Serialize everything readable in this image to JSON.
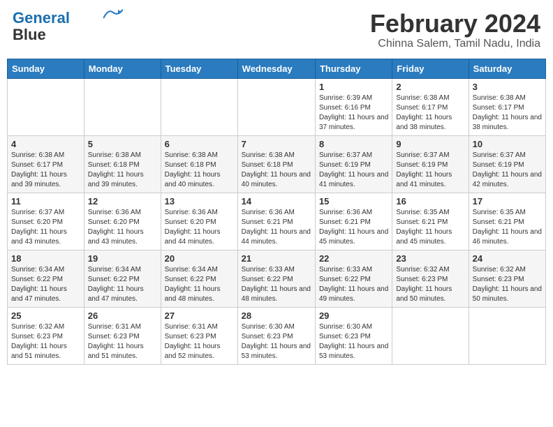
{
  "app": {
    "name": "GeneralBlue",
    "logo_line1": "General",
    "logo_line2": "Blue"
  },
  "header": {
    "month_year": "February 2024",
    "location": "Chinna Salem, Tamil Nadu, India"
  },
  "weekdays": [
    "Sunday",
    "Monday",
    "Tuesday",
    "Wednesday",
    "Thursday",
    "Friday",
    "Saturday"
  ],
  "weeks": [
    [
      {
        "day": "",
        "sunrise": "",
        "sunset": "",
        "daylight": ""
      },
      {
        "day": "",
        "sunrise": "",
        "sunset": "",
        "daylight": ""
      },
      {
        "day": "",
        "sunrise": "",
        "sunset": "",
        "daylight": ""
      },
      {
        "day": "",
        "sunrise": "",
        "sunset": "",
        "daylight": ""
      },
      {
        "day": "1",
        "sunrise": "Sunrise: 6:39 AM",
        "sunset": "Sunset: 6:16 PM",
        "daylight": "Daylight: 11 hours and 37 minutes."
      },
      {
        "day": "2",
        "sunrise": "Sunrise: 6:38 AM",
        "sunset": "Sunset: 6:17 PM",
        "daylight": "Daylight: 11 hours and 38 minutes."
      },
      {
        "day": "3",
        "sunrise": "Sunrise: 6:38 AM",
        "sunset": "Sunset: 6:17 PM",
        "daylight": "Daylight: 11 hours and 38 minutes."
      }
    ],
    [
      {
        "day": "4",
        "sunrise": "Sunrise: 6:38 AM",
        "sunset": "Sunset: 6:17 PM",
        "daylight": "Daylight: 11 hours and 39 minutes."
      },
      {
        "day": "5",
        "sunrise": "Sunrise: 6:38 AM",
        "sunset": "Sunset: 6:18 PM",
        "daylight": "Daylight: 11 hours and 39 minutes."
      },
      {
        "day": "6",
        "sunrise": "Sunrise: 6:38 AM",
        "sunset": "Sunset: 6:18 PM",
        "daylight": "Daylight: 11 hours and 40 minutes."
      },
      {
        "day": "7",
        "sunrise": "Sunrise: 6:38 AM",
        "sunset": "Sunset: 6:18 PM",
        "daylight": "Daylight: 11 hours and 40 minutes."
      },
      {
        "day": "8",
        "sunrise": "Sunrise: 6:37 AM",
        "sunset": "Sunset: 6:19 PM",
        "daylight": "Daylight: 11 hours and 41 minutes."
      },
      {
        "day": "9",
        "sunrise": "Sunrise: 6:37 AM",
        "sunset": "Sunset: 6:19 PM",
        "daylight": "Daylight: 11 hours and 41 minutes."
      },
      {
        "day": "10",
        "sunrise": "Sunrise: 6:37 AM",
        "sunset": "Sunset: 6:19 PM",
        "daylight": "Daylight: 11 hours and 42 minutes."
      }
    ],
    [
      {
        "day": "11",
        "sunrise": "Sunrise: 6:37 AM",
        "sunset": "Sunset: 6:20 PM",
        "daylight": "Daylight: 11 hours and 43 minutes."
      },
      {
        "day": "12",
        "sunrise": "Sunrise: 6:36 AM",
        "sunset": "Sunset: 6:20 PM",
        "daylight": "Daylight: 11 hours and 43 minutes."
      },
      {
        "day": "13",
        "sunrise": "Sunrise: 6:36 AM",
        "sunset": "Sunset: 6:20 PM",
        "daylight": "Daylight: 11 hours and 44 minutes."
      },
      {
        "day": "14",
        "sunrise": "Sunrise: 6:36 AM",
        "sunset": "Sunset: 6:21 PM",
        "daylight": "Daylight: 11 hours and 44 minutes."
      },
      {
        "day": "15",
        "sunrise": "Sunrise: 6:36 AM",
        "sunset": "Sunset: 6:21 PM",
        "daylight": "Daylight: 11 hours and 45 minutes."
      },
      {
        "day": "16",
        "sunrise": "Sunrise: 6:35 AM",
        "sunset": "Sunset: 6:21 PM",
        "daylight": "Daylight: 11 hours and 45 minutes."
      },
      {
        "day": "17",
        "sunrise": "Sunrise: 6:35 AM",
        "sunset": "Sunset: 6:21 PM",
        "daylight": "Daylight: 11 hours and 46 minutes."
      }
    ],
    [
      {
        "day": "18",
        "sunrise": "Sunrise: 6:34 AM",
        "sunset": "Sunset: 6:22 PM",
        "daylight": "Daylight: 11 hours and 47 minutes."
      },
      {
        "day": "19",
        "sunrise": "Sunrise: 6:34 AM",
        "sunset": "Sunset: 6:22 PM",
        "daylight": "Daylight: 11 hours and 47 minutes."
      },
      {
        "day": "20",
        "sunrise": "Sunrise: 6:34 AM",
        "sunset": "Sunset: 6:22 PM",
        "daylight": "Daylight: 11 hours and 48 minutes."
      },
      {
        "day": "21",
        "sunrise": "Sunrise: 6:33 AM",
        "sunset": "Sunset: 6:22 PM",
        "daylight": "Daylight: 11 hours and 48 minutes."
      },
      {
        "day": "22",
        "sunrise": "Sunrise: 6:33 AM",
        "sunset": "Sunset: 6:22 PM",
        "daylight": "Daylight: 11 hours and 49 minutes."
      },
      {
        "day": "23",
        "sunrise": "Sunrise: 6:32 AM",
        "sunset": "Sunset: 6:23 PM",
        "daylight": "Daylight: 11 hours and 50 minutes."
      },
      {
        "day": "24",
        "sunrise": "Sunrise: 6:32 AM",
        "sunset": "Sunset: 6:23 PM",
        "daylight": "Daylight: 11 hours and 50 minutes."
      }
    ],
    [
      {
        "day": "25",
        "sunrise": "Sunrise: 6:32 AM",
        "sunset": "Sunset: 6:23 PM",
        "daylight": "Daylight: 11 hours and 51 minutes."
      },
      {
        "day": "26",
        "sunrise": "Sunrise: 6:31 AM",
        "sunset": "Sunset: 6:23 PM",
        "daylight": "Daylight: 11 hours and 51 minutes."
      },
      {
        "day": "27",
        "sunrise": "Sunrise: 6:31 AM",
        "sunset": "Sunset: 6:23 PM",
        "daylight": "Daylight: 11 hours and 52 minutes."
      },
      {
        "day": "28",
        "sunrise": "Sunrise: 6:30 AM",
        "sunset": "Sunset: 6:23 PM",
        "daylight": "Daylight: 11 hours and 53 minutes."
      },
      {
        "day": "29",
        "sunrise": "Sunrise: 6:30 AM",
        "sunset": "Sunset: 6:23 PM",
        "daylight": "Daylight: 11 hours and 53 minutes."
      },
      {
        "day": "",
        "sunrise": "",
        "sunset": "",
        "daylight": ""
      },
      {
        "day": "",
        "sunrise": "",
        "sunset": "",
        "daylight": ""
      }
    ]
  ]
}
